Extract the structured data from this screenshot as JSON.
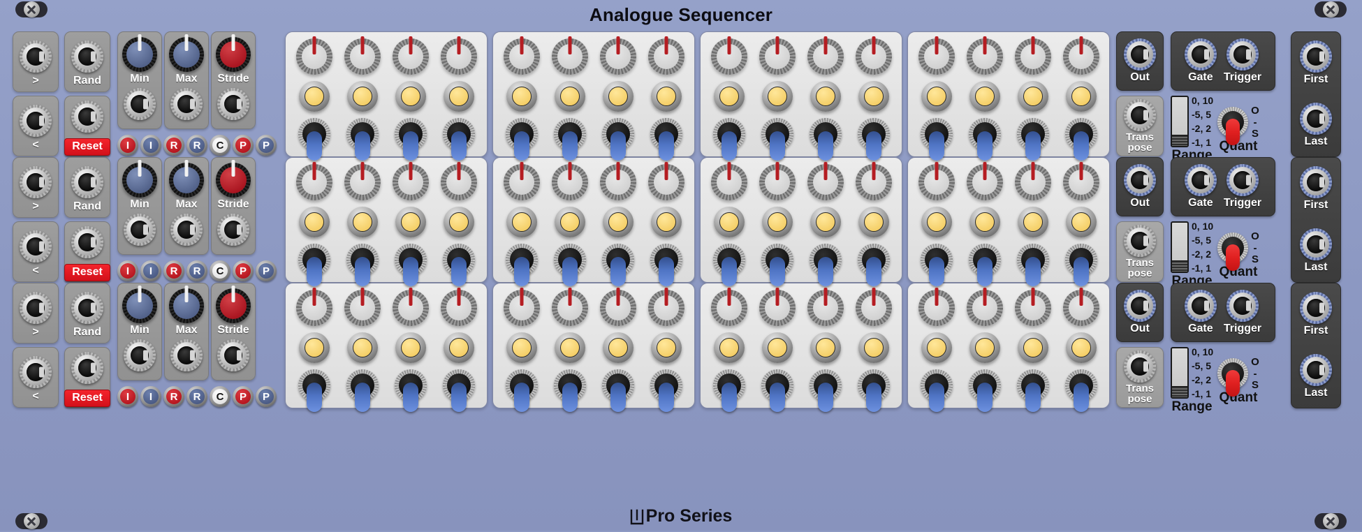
{
  "window": {
    "title": "Analogue Sequencer",
    "footer_brand": "Pro Series",
    "footer_logo": "m-logo-icon",
    "background_color": "#8e9ac4"
  },
  "screws": [
    {
      "name": "screw-top-left"
    },
    {
      "name": "screw-top-right"
    },
    {
      "name": "screw-bottom-left"
    },
    {
      "name": "screw-bottom-right"
    }
  ],
  "colors": {
    "panel": "#8e9ac4",
    "step_group": "#e4e4e4",
    "knob_pointer_red": "#b51d22",
    "led_yellow": "#f5d06a",
    "toggle_blue": "#4f74c4",
    "reset_red": "#e6141e",
    "jack_ring_blue": "#6d82b8",
    "quant_lever_red": "#e02020"
  },
  "rows": [
    {
      "name": "sequencer-row-1",
      "left_controls": {
        "step_forward": {
          "label": ">",
          "jack": "jack-step-forward"
        },
        "step_back": {
          "label": "<",
          "jack": "jack-step-back"
        },
        "rand": {
          "label": "Rand",
          "jack": "jack-rand"
        },
        "reset": {
          "label": "Reset",
          "jack": "jack-reset"
        },
        "min": {
          "label": "Min",
          "knob_color": "blue",
          "value_angle": 0,
          "jack": "jack-min"
        },
        "max": {
          "label": "Max",
          "knob_color": "blue",
          "value_angle": 0,
          "jack": "jack-max"
        },
        "stride": {
          "label": "Stride",
          "knob_color": "red",
          "value_angle": 0,
          "jack": "jack-stride"
        },
        "mode_buttons": [
          {
            "label": "I",
            "color": "red"
          },
          {
            "label": "I",
            "color": "blue"
          },
          {
            "label": "R",
            "color": "red"
          },
          {
            "label": "R",
            "color": "blue"
          },
          {
            "label": "C",
            "color": "white"
          },
          {
            "label": "P",
            "color": "red"
          },
          {
            "label": "P",
            "color": "blue"
          }
        ]
      },
      "step_groups": [
        {
          "name": "step-group-1",
          "steps": [
            {
              "knob_angle": 0,
              "led_on": true,
              "toggle_on": true
            },
            {
              "knob_angle": 0,
              "led_on": true,
              "toggle_on": true
            },
            {
              "knob_angle": 0,
              "led_on": true,
              "toggle_on": true
            },
            {
              "knob_angle": 0,
              "led_on": true,
              "toggle_on": true
            }
          ]
        },
        {
          "name": "step-group-2",
          "steps": [
            {
              "knob_angle": 0,
              "led_on": true,
              "toggle_on": true
            },
            {
              "knob_angle": 0,
              "led_on": true,
              "toggle_on": true
            },
            {
              "knob_angle": 0,
              "led_on": true,
              "toggle_on": true
            },
            {
              "knob_angle": 0,
              "led_on": true,
              "toggle_on": true
            }
          ]
        },
        {
          "name": "step-group-3",
          "steps": [
            {
              "knob_angle": 0,
              "led_on": true,
              "toggle_on": true
            },
            {
              "knob_angle": 0,
              "led_on": true,
              "toggle_on": true
            },
            {
              "knob_angle": 0,
              "led_on": true,
              "toggle_on": true
            },
            {
              "knob_angle": 0,
              "led_on": true,
              "toggle_on": true
            }
          ]
        },
        {
          "name": "step-group-4",
          "steps": [
            {
              "knob_angle": 0,
              "led_on": true,
              "toggle_on": true
            },
            {
              "knob_angle": 0,
              "led_on": true,
              "toggle_on": true
            },
            {
              "knob_angle": 0,
              "led_on": true,
              "toggle_on": true
            },
            {
              "knob_angle": 0,
              "led_on": true,
              "toggle_on": true
            }
          ]
        }
      ],
      "right_controls": {
        "out": {
          "label": "Out"
        },
        "transpose": {
          "label_line1": "Trans",
          "label_line2": "pose"
        },
        "gate": {
          "label": "Gate"
        },
        "trigger": {
          "label": "Trigger"
        },
        "range": {
          "label": "Range",
          "options": [
            "0, 10",
            "-5, 5",
            "-2, 2",
            "-1, 1"
          ],
          "selected": "-1, 1"
        },
        "quant": {
          "label": "Quant",
          "positions": [
            "O",
            "-",
            "S"
          ],
          "selected": "-"
        },
        "first": {
          "label": "First"
        },
        "last": {
          "label": "Last"
        }
      }
    },
    {
      "name": "sequencer-row-2",
      "left_controls": {
        "step_forward": {
          "label": ">",
          "jack": "jack-step-forward"
        },
        "step_back": {
          "label": "<",
          "jack": "jack-step-back"
        },
        "rand": {
          "label": "Rand",
          "jack": "jack-rand"
        },
        "reset": {
          "label": "Reset",
          "jack": "jack-reset"
        },
        "min": {
          "label": "Min",
          "knob_color": "blue",
          "value_angle": 0,
          "jack": "jack-min"
        },
        "max": {
          "label": "Max",
          "knob_color": "blue",
          "value_angle": 0,
          "jack": "jack-max"
        },
        "stride": {
          "label": "Stride",
          "knob_color": "red",
          "value_angle": 0,
          "jack": "jack-stride"
        },
        "mode_buttons": [
          {
            "label": "I",
            "color": "red"
          },
          {
            "label": "I",
            "color": "blue"
          },
          {
            "label": "R",
            "color": "red"
          },
          {
            "label": "R",
            "color": "blue"
          },
          {
            "label": "C",
            "color": "white"
          },
          {
            "label": "P",
            "color": "red"
          },
          {
            "label": "P",
            "color": "blue"
          }
        ]
      },
      "step_groups": [
        {
          "name": "step-group-1",
          "steps": [
            {
              "knob_angle": 0,
              "led_on": true,
              "toggle_on": true
            },
            {
              "knob_angle": 0,
              "led_on": true,
              "toggle_on": true
            },
            {
              "knob_angle": 0,
              "led_on": true,
              "toggle_on": true
            },
            {
              "knob_angle": 0,
              "led_on": true,
              "toggle_on": true
            }
          ]
        },
        {
          "name": "step-group-2",
          "steps": [
            {
              "knob_angle": 0,
              "led_on": true,
              "toggle_on": true
            },
            {
              "knob_angle": 0,
              "led_on": true,
              "toggle_on": true
            },
            {
              "knob_angle": 0,
              "led_on": true,
              "toggle_on": true
            },
            {
              "knob_angle": 0,
              "led_on": true,
              "toggle_on": true
            }
          ]
        },
        {
          "name": "step-group-3",
          "steps": [
            {
              "knob_angle": 0,
              "led_on": true,
              "toggle_on": true
            },
            {
              "knob_angle": 0,
              "led_on": true,
              "toggle_on": true
            },
            {
              "knob_angle": 0,
              "led_on": true,
              "toggle_on": true
            },
            {
              "knob_angle": 0,
              "led_on": true,
              "toggle_on": true
            }
          ]
        },
        {
          "name": "step-group-4",
          "steps": [
            {
              "knob_angle": 0,
              "led_on": true,
              "toggle_on": true
            },
            {
              "knob_angle": 0,
              "led_on": true,
              "toggle_on": true
            },
            {
              "knob_angle": 0,
              "led_on": true,
              "toggle_on": true
            },
            {
              "knob_angle": 0,
              "led_on": true,
              "toggle_on": true
            }
          ]
        }
      ],
      "right_controls": {
        "out": {
          "label": "Out"
        },
        "transpose": {
          "label_line1": "Trans",
          "label_line2": "pose"
        },
        "gate": {
          "label": "Gate"
        },
        "trigger": {
          "label": "Trigger"
        },
        "range": {
          "label": "Range",
          "options": [
            "0, 10",
            "-5, 5",
            "-2, 2",
            "-1, 1"
          ],
          "selected": "-1, 1"
        },
        "quant": {
          "label": "Quant",
          "positions": [
            "O",
            "-",
            "S"
          ],
          "selected": "-"
        },
        "first": {
          "label": "First"
        },
        "last": {
          "label": "Last"
        }
      }
    },
    {
      "name": "sequencer-row-3",
      "left_controls": {
        "step_forward": {
          "label": ">",
          "jack": "jack-step-forward"
        },
        "step_back": {
          "label": "<",
          "jack": "jack-step-back"
        },
        "rand": {
          "label": "Rand",
          "jack": "jack-rand"
        },
        "reset": {
          "label": "Reset",
          "jack": "jack-reset"
        },
        "min": {
          "label": "Min",
          "knob_color": "blue",
          "value_angle": 0,
          "jack": "jack-min"
        },
        "max": {
          "label": "Max",
          "knob_color": "blue",
          "value_angle": 0,
          "jack": "jack-max"
        },
        "stride": {
          "label": "Stride",
          "knob_color": "red",
          "value_angle": 0,
          "jack": "jack-stride"
        },
        "mode_buttons": [
          {
            "label": "I",
            "color": "red"
          },
          {
            "label": "I",
            "color": "blue"
          },
          {
            "label": "R",
            "color": "red"
          },
          {
            "label": "R",
            "color": "blue"
          },
          {
            "label": "C",
            "color": "white"
          },
          {
            "label": "P",
            "color": "red"
          },
          {
            "label": "P",
            "color": "blue"
          }
        ]
      },
      "step_groups": [
        {
          "name": "step-group-1",
          "steps": [
            {
              "knob_angle": 0,
              "led_on": true,
              "toggle_on": true
            },
            {
              "knob_angle": 0,
              "led_on": true,
              "toggle_on": true
            },
            {
              "knob_angle": 0,
              "led_on": true,
              "toggle_on": true
            },
            {
              "knob_angle": 0,
              "led_on": true,
              "toggle_on": true
            }
          ]
        },
        {
          "name": "step-group-2",
          "steps": [
            {
              "knob_angle": 0,
              "led_on": true,
              "toggle_on": true
            },
            {
              "knob_angle": 0,
              "led_on": true,
              "toggle_on": true
            },
            {
              "knob_angle": 0,
              "led_on": true,
              "toggle_on": true
            },
            {
              "knob_angle": 0,
              "led_on": true,
              "toggle_on": true
            }
          ]
        },
        {
          "name": "step-group-3",
          "steps": [
            {
              "knob_angle": 0,
              "led_on": true,
              "toggle_on": true
            },
            {
              "knob_angle": 0,
              "led_on": true,
              "toggle_on": true
            },
            {
              "knob_angle": 0,
              "led_on": true,
              "toggle_on": true
            },
            {
              "knob_angle": 0,
              "led_on": true,
              "toggle_on": true
            }
          ]
        },
        {
          "name": "step-group-4",
          "steps": [
            {
              "knob_angle": 0,
              "led_on": true,
              "toggle_on": true
            },
            {
              "knob_angle": 0,
              "led_on": true,
              "toggle_on": true
            },
            {
              "knob_angle": 0,
              "led_on": true,
              "toggle_on": true
            },
            {
              "knob_angle": 0,
              "led_on": true,
              "toggle_on": true
            }
          ]
        }
      ],
      "right_controls": {
        "out": {
          "label": "Out"
        },
        "transpose": {
          "label_line1": "Trans",
          "label_line2": "pose"
        },
        "gate": {
          "label": "Gate"
        },
        "trigger": {
          "label": "Trigger"
        },
        "range": {
          "label": "Range",
          "options": [
            "0, 10",
            "-5, 5",
            "-2, 2",
            "-1, 1"
          ],
          "selected": "-1, 1"
        },
        "quant": {
          "label": "Quant",
          "positions": [
            "O",
            "-",
            "S"
          ],
          "selected": "-"
        },
        "first": {
          "label": "First"
        },
        "last": {
          "label": "Last"
        }
      }
    }
  ]
}
